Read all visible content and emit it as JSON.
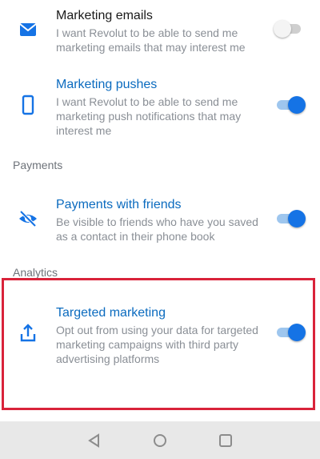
{
  "items": [
    {
      "title": "Marketing emails",
      "description": "I want Revolut to be able to send me marketing emails that may interest me",
      "icon": "mail-icon",
      "toggle_on": false
    },
    {
      "title": "Marketing pushes",
      "description": "I want Revolut to be able to send me marketing push notifications that may interest me",
      "icon": "phone-icon",
      "toggle_on": true
    },
    {
      "title": "Payments with friends",
      "description": "Be visible to friends who have you saved as a contact in their phone book",
      "icon": "eye-off-icon",
      "toggle_on": true
    },
    {
      "title": "Targeted marketing",
      "description": "Opt out from using your data for targeted marketing campaigns with third party advertising platforms",
      "icon": "share-upload-icon",
      "toggle_on": true
    }
  ],
  "sections": {
    "payments": "Payments",
    "analytics": "Analytics"
  },
  "colors": {
    "accent": "#0b6bbf",
    "toggle_on": "#1573e5",
    "highlight": "#d9233a"
  },
  "navbar": {
    "buttons": [
      "back-icon",
      "home-icon",
      "recents-icon"
    ]
  }
}
